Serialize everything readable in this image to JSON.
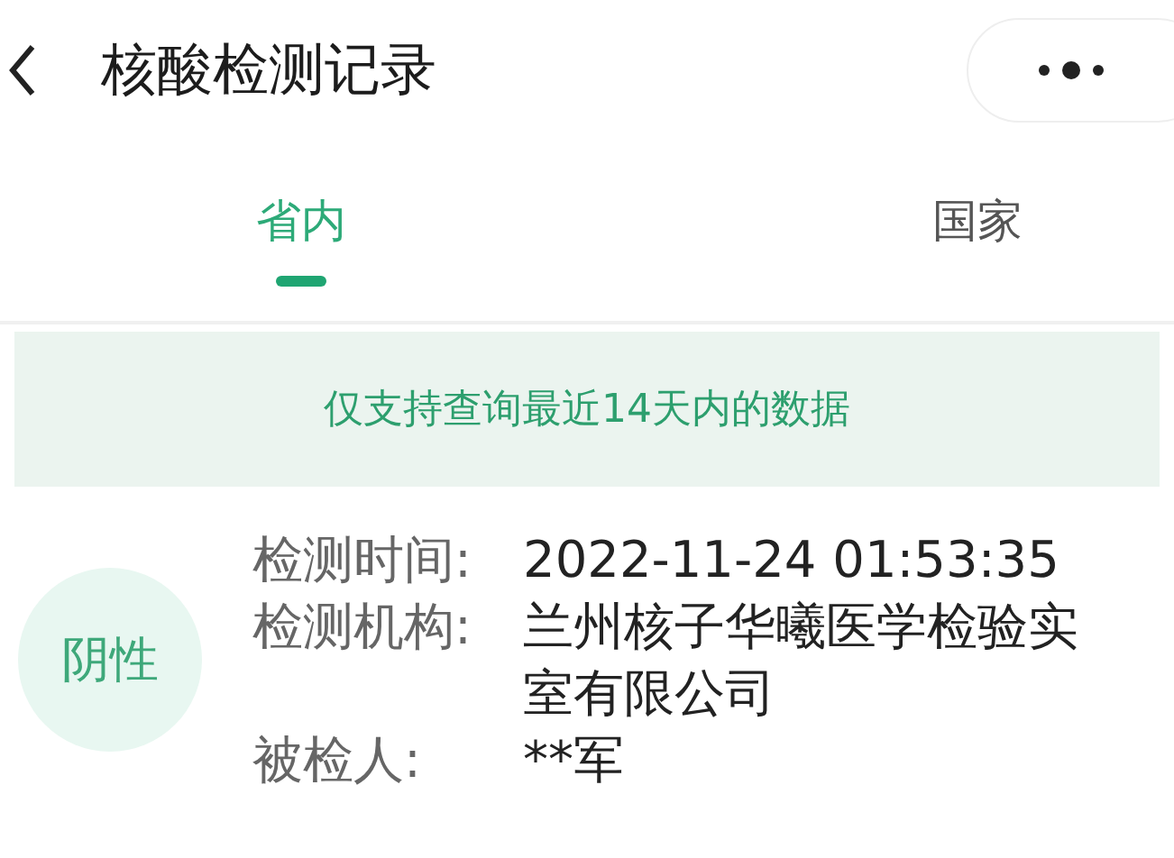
{
  "header": {
    "title": "核酸检测记录"
  },
  "tabs": [
    {
      "label": "省内",
      "selected": true
    },
    {
      "label": "国家",
      "selected": false
    }
  ],
  "notice": "仅支持查询最近14天内的数据",
  "record": {
    "result": "阴性",
    "fields": [
      {
        "label": "检测时间:",
        "value": "2022-11-24 01:53:35"
      },
      {
        "label": "检测机构:",
        "value": "兰州核子华曦医学检验实室有限公司"
      },
      {
        "label": "被检人:",
        "value": "**军"
      }
    ]
  }
}
